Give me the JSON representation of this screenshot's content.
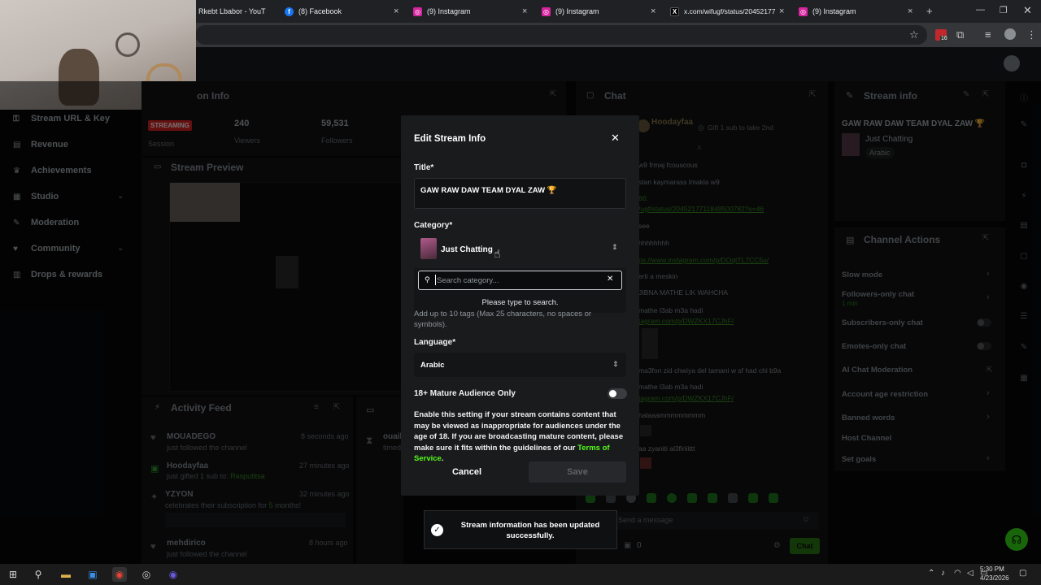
{
  "browser": {
    "tabs": [
      {
        "label": "Rkebt Lbabor - YouT",
        "icon": "youtube-icon"
      },
      {
        "label": "(8) Facebook",
        "icon": "facebook-icon"
      },
      {
        "label": "(9) Instagram",
        "icon": "instagram-icon"
      },
      {
        "label": "(9) Instagram",
        "icon": "instagram-icon"
      },
      {
        "label": "x.com/wifugf/status/20452177",
        "icon": "x-icon"
      },
      {
        "label": "(9) Instagram",
        "icon": "instagram-icon"
      }
    ],
    "new_tab": "+",
    "extension_badge": "16"
  },
  "sidebar": {
    "items": [
      {
        "label": "Stream URL & Key",
        "icon": "key-icon"
      },
      {
        "label": "Revenue",
        "icon": "revenue-icon"
      },
      {
        "label": "Achievements",
        "icon": "trophy-icon"
      },
      {
        "label": "Studio",
        "icon": "studio-icon"
      },
      {
        "label": "Moderation",
        "icon": "wrench-icon"
      },
      {
        "label": "Community",
        "icon": "community-icon"
      },
      {
        "label": "Drops & rewards",
        "icon": "drops-icon"
      }
    ]
  },
  "session": {
    "title_partial": "on Info",
    "status": "STREAMING",
    "session_label": "Session",
    "viewers": "240",
    "viewers_label": "Viewers",
    "followers": "59,531",
    "followers_label": "Followers"
  },
  "preview": {
    "title": "Stream Preview"
  },
  "activity": {
    "title": "Activity Feed",
    "items": [
      {
        "name": "MOUADEGO",
        "text": "just followed the channel",
        "time": "8 seconds ago"
      },
      {
        "name": "Hoodayfaa",
        "text_pre": "just gifted ",
        "text_count": "1",
        "text_mid": " sub to: ",
        "text_target": "Rasputitsa",
        "time": "27 minutes ago"
      },
      {
        "name": "YZYON",
        "text_pre": "celebrates their subscription for ",
        "text_count": "5",
        "text_mid": " months!",
        "time": "32 minutes ago"
      },
      {
        "name": "mehdirico",
        "text": "just followed the channel",
        "time": "8 hours ago"
      }
    ],
    "second_panel_partial": "ouail",
    "second_panel_sub": "timed"
  },
  "chat": {
    "title": "Chat",
    "pinned_user": "Hoodayfaa",
    "pinned_text": "Gift 1 sub to take 2nd",
    "lines": [
      "w9 frmaj fcouscous",
      "stan kaymarass lmakla w9",
      "66:",
      "/ugf/status/2045217711849500782?s=46",
      "see",
      "hhhhhhhh",
      "ps://www.instagram.com/p/DOqtTL7CC5u/",
      "erti a meskin",
      "JIBNA MATHE LIK WAHCHA",
      "mathe l3ab m3a hadi",
      "tagram.com/p/DWZKX17CJhF/",
      "ma3fon zid chwiya del tamani w sf had chi b9a",
      "mathe l3ab m3a hadi",
      "tagram.com/p/DWZKX17CJhF/",
      "halaaammmmmmmm",
      "aa zyaniti al3firiiittt"
    ],
    "input_placeholder": "Send a message",
    "points": "0",
    "send_label": "Chat"
  },
  "stream_info": {
    "title": "Stream info",
    "stream_title": "GAW RAW DAW TEAM DYAL ZAW 🏆",
    "category": "Just Chatting",
    "language": "Arabic"
  },
  "channel_actions": {
    "title": "Channel Actions",
    "items": [
      {
        "label": "Slow mode"
      },
      {
        "label": "Followers-only chat",
        "sub": "1 min"
      },
      {
        "label": "Subscribers-only chat"
      },
      {
        "label": "Emotes-only chat"
      },
      {
        "label": "AI Chat Moderation"
      },
      {
        "label": "Account age restriction"
      },
      {
        "label": "Banned words"
      },
      {
        "label": "Host Channel"
      },
      {
        "label": "Set goals"
      }
    ]
  },
  "modal": {
    "title": "Edit Stream Info",
    "title_label": "Title*",
    "title_value": "GAW RAW DAW TEAM DYAL ZAW 🏆",
    "category_label": "Category*",
    "category_value": "Just Chatting",
    "search_placeholder": "Search category...",
    "search_hint": "Please type to search.",
    "tags_help": "Add up to 10 tags (Max 25 characters, no spaces or symbols).",
    "language_label": "Language*",
    "language_value": "Arabic",
    "mature_label": "18+ Mature Audience Only",
    "mature_enabled": false,
    "mature_desc": "Enable this setting if your stream contains content that may be viewed as inappropriate for audiences under the age of 18. If you are broadcasting mature content, please make sure it fits within the guidelines of our ",
    "terms_link": "Terms of Service",
    "terms_end": ".",
    "cancel_label": "Cancel",
    "save_label": "Save"
  },
  "toast": {
    "message": "Stream information has been updated successfully."
  },
  "taskbar": {
    "time": "5:30 PM",
    "date": "4/23/2026"
  },
  "colors": {
    "accent": "#53fc18",
    "streaming": "#e02424",
    "modal_bg": "#1a1b1d"
  }
}
